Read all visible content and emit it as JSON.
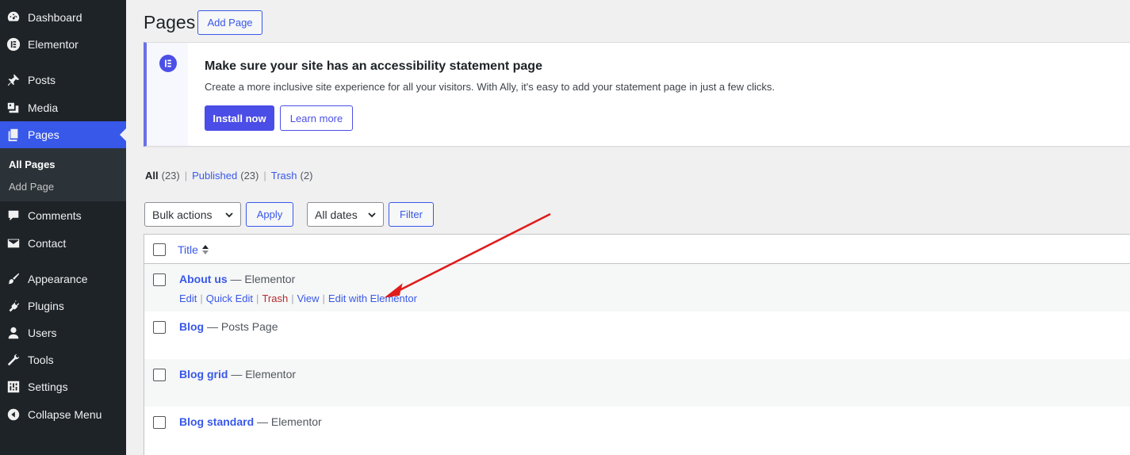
{
  "sidebar": {
    "items": [
      {
        "label": "Dashboard",
        "icon": "dashboard-icon"
      },
      {
        "label": "Elementor",
        "icon": "elementor-icon"
      },
      {
        "label": "Posts",
        "icon": "pin-icon"
      },
      {
        "label": "Media",
        "icon": "media-icon"
      },
      {
        "label": "Pages",
        "icon": "pages-icon"
      },
      {
        "label": "Comments",
        "icon": "comments-icon"
      },
      {
        "label": "Contact",
        "icon": "mail-icon"
      },
      {
        "label": "Appearance",
        "icon": "brush-icon"
      },
      {
        "label": "Plugins",
        "icon": "plugin-icon"
      },
      {
        "label": "Users",
        "icon": "user-icon"
      },
      {
        "label": "Tools",
        "icon": "wrench-icon"
      },
      {
        "label": "Settings",
        "icon": "settings-icon"
      },
      {
        "label": "Collapse Menu",
        "icon": "collapse-icon"
      }
    ],
    "submenu": [
      "All Pages",
      "Add Page"
    ],
    "active": "Pages"
  },
  "header": {
    "title": "Pages",
    "add_button": "Add Page"
  },
  "notice": {
    "title": "Make sure your site has an accessibility statement page",
    "text": "Create a more inclusive site experience for all your visitors. With Ally, it's easy to add your statement page in just a few clicks.",
    "install_button": "Install now",
    "learn_button": "Learn more"
  },
  "filters": {
    "all_label": "All",
    "all_count": "(23)",
    "published_label": "Published",
    "published_count": "(23)",
    "trash_label": "Trash",
    "trash_count": "(2)"
  },
  "tablenav": {
    "bulk_actions": "Bulk actions",
    "apply": "Apply",
    "all_dates": "All dates",
    "filter": "Filter"
  },
  "table": {
    "column_title": "Title",
    "rows": [
      {
        "title": "About us",
        "state": "— Elementor"
      },
      {
        "title": "Blog",
        "state": "— Posts Page"
      },
      {
        "title": "Blog grid",
        "state": "— Elementor"
      },
      {
        "title": "Blog standard",
        "state": "— Elementor"
      }
    ],
    "row_actions": {
      "edit": "Edit",
      "quick_edit": "Quick Edit",
      "trash": "Trash",
      "view": "View",
      "edit_elementor": "Edit with Elementor"
    }
  },
  "colors": {
    "accent": "#3858e9",
    "sidebar_bg": "#1d2327",
    "annotation_arrow": "#e01b1b"
  }
}
